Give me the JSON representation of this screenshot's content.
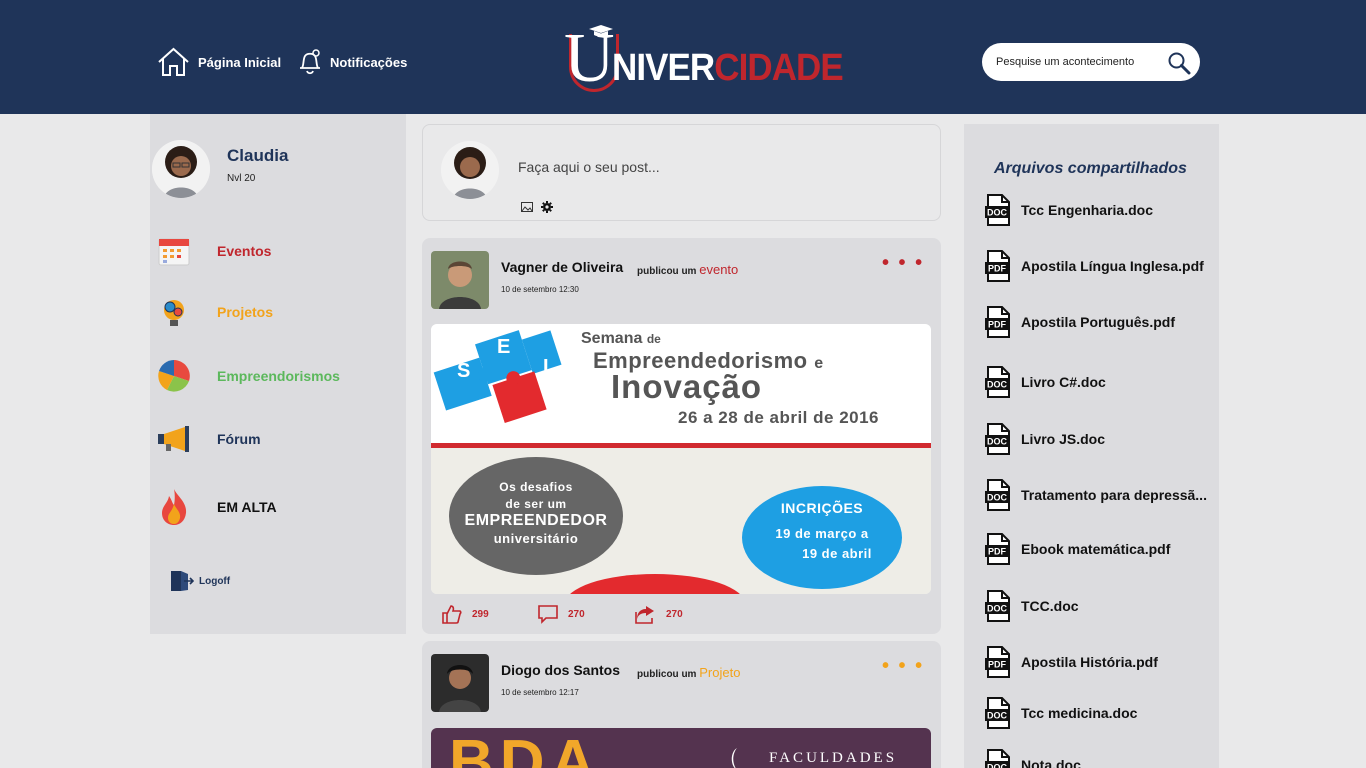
{
  "header": {
    "home_label": "Página Inicial",
    "notifications_label": "Notificações",
    "logo": {
      "letter": "U",
      "part1": "NIVER",
      "part2": "CIDADE"
    },
    "search_placeholder": "Pesquise um acontecimento"
  },
  "profile": {
    "name": "Claudia",
    "level": "Nvl 20"
  },
  "menu": [
    {
      "label": "Eventos",
      "color": "#c0262d",
      "icon": "calendar-icon"
    },
    {
      "label": "Projetos",
      "color": "#f2a31b",
      "icon": "lightbulb-gears-icon"
    },
    {
      "label": "Empreendorismos",
      "color": "#5cb85c",
      "icon": "pie-chart-icon"
    },
    {
      "label": "Fórum",
      "color": "#1f3459",
      "icon": "megaphone-icon"
    },
    {
      "label": "EM ALTA",
      "color": "#111111",
      "icon": "fire-icon"
    }
  ],
  "logoff_label": "Logoff",
  "composer": {
    "placeholder": "Faça aqui o seu post..."
  },
  "posts": [
    {
      "author": "Vagner de Oliveira",
      "verb": "publicou um",
      "kind": "evento",
      "kind_color": "#c0262d",
      "date": "10 de setembro 12:30",
      "more": "• • •",
      "image": {
        "semana": "Semana",
        "de": "de",
        "empreendedorismo": "Empreendedorismo",
        "e": "e",
        "inovacao": "Inovação",
        "dates": "26 a 28 de abril de 2016",
        "puzzle_letters": [
          "S",
          "E",
          "I"
        ],
        "circle1_line1": "Os desafios",
        "circle1_line2": "de ser um",
        "circle1_line3": "EMPREENDEDOR",
        "circle1_line4": "universitário",
        "circle2_line1": "INCRIÇÕES",
        "circle2_line2": "19 de março a",
        "circle2_line3": "19 de abril"
      },
      "likes": "299",
      "comments": "270",
      "shares": "270"
    },
    {
      "author": "Diogo dos Santos",
      "verb": "publicou um",
      "kind": "Projeto",
      "kind_color": "#f2a31b",
      "date": "10 de setembro 12:17",
      "more": "• • •",
      "image": {
        "big": "BDA",
        "faculdades": "FACULDADES"
      }
    }
  ],
  "files_title": "Arquivos compartilhados",
  "files": [
    {
      "name": "Tcc Engenharia.doc",
      "type": "DOC"
    },
    {
      "name": "Apostila Língua Inglesa.pdf",
      "type": "PDF"
    },
    {
      "name": "Apostila Português.pdf",
      "type": "PDF"
    },
    {
      "name": "Livro C#.doc",
      "type": "DOC"
    },
    {
      "name": "Livro JS.doc",
      "type": "DOC"
    },
    {
      "name": "Tratamento para depressã...",
      "type": "DOC"
    },
    {
      "name": "Ebook matemática.pdf",
      "type": "PDF"
    },
    {
      "name": "TCC.doc",
      "type": "DOC"
    },
    {
      "name": "Apostila História.pdf",
      "type": "PDF"
    },
    {
      "name": "Tcc medicina.doc",
      "type": "DOC"
    },
    {
      "name": "Nota.doc",
      "type": "DOC"
    }
  ]
}
